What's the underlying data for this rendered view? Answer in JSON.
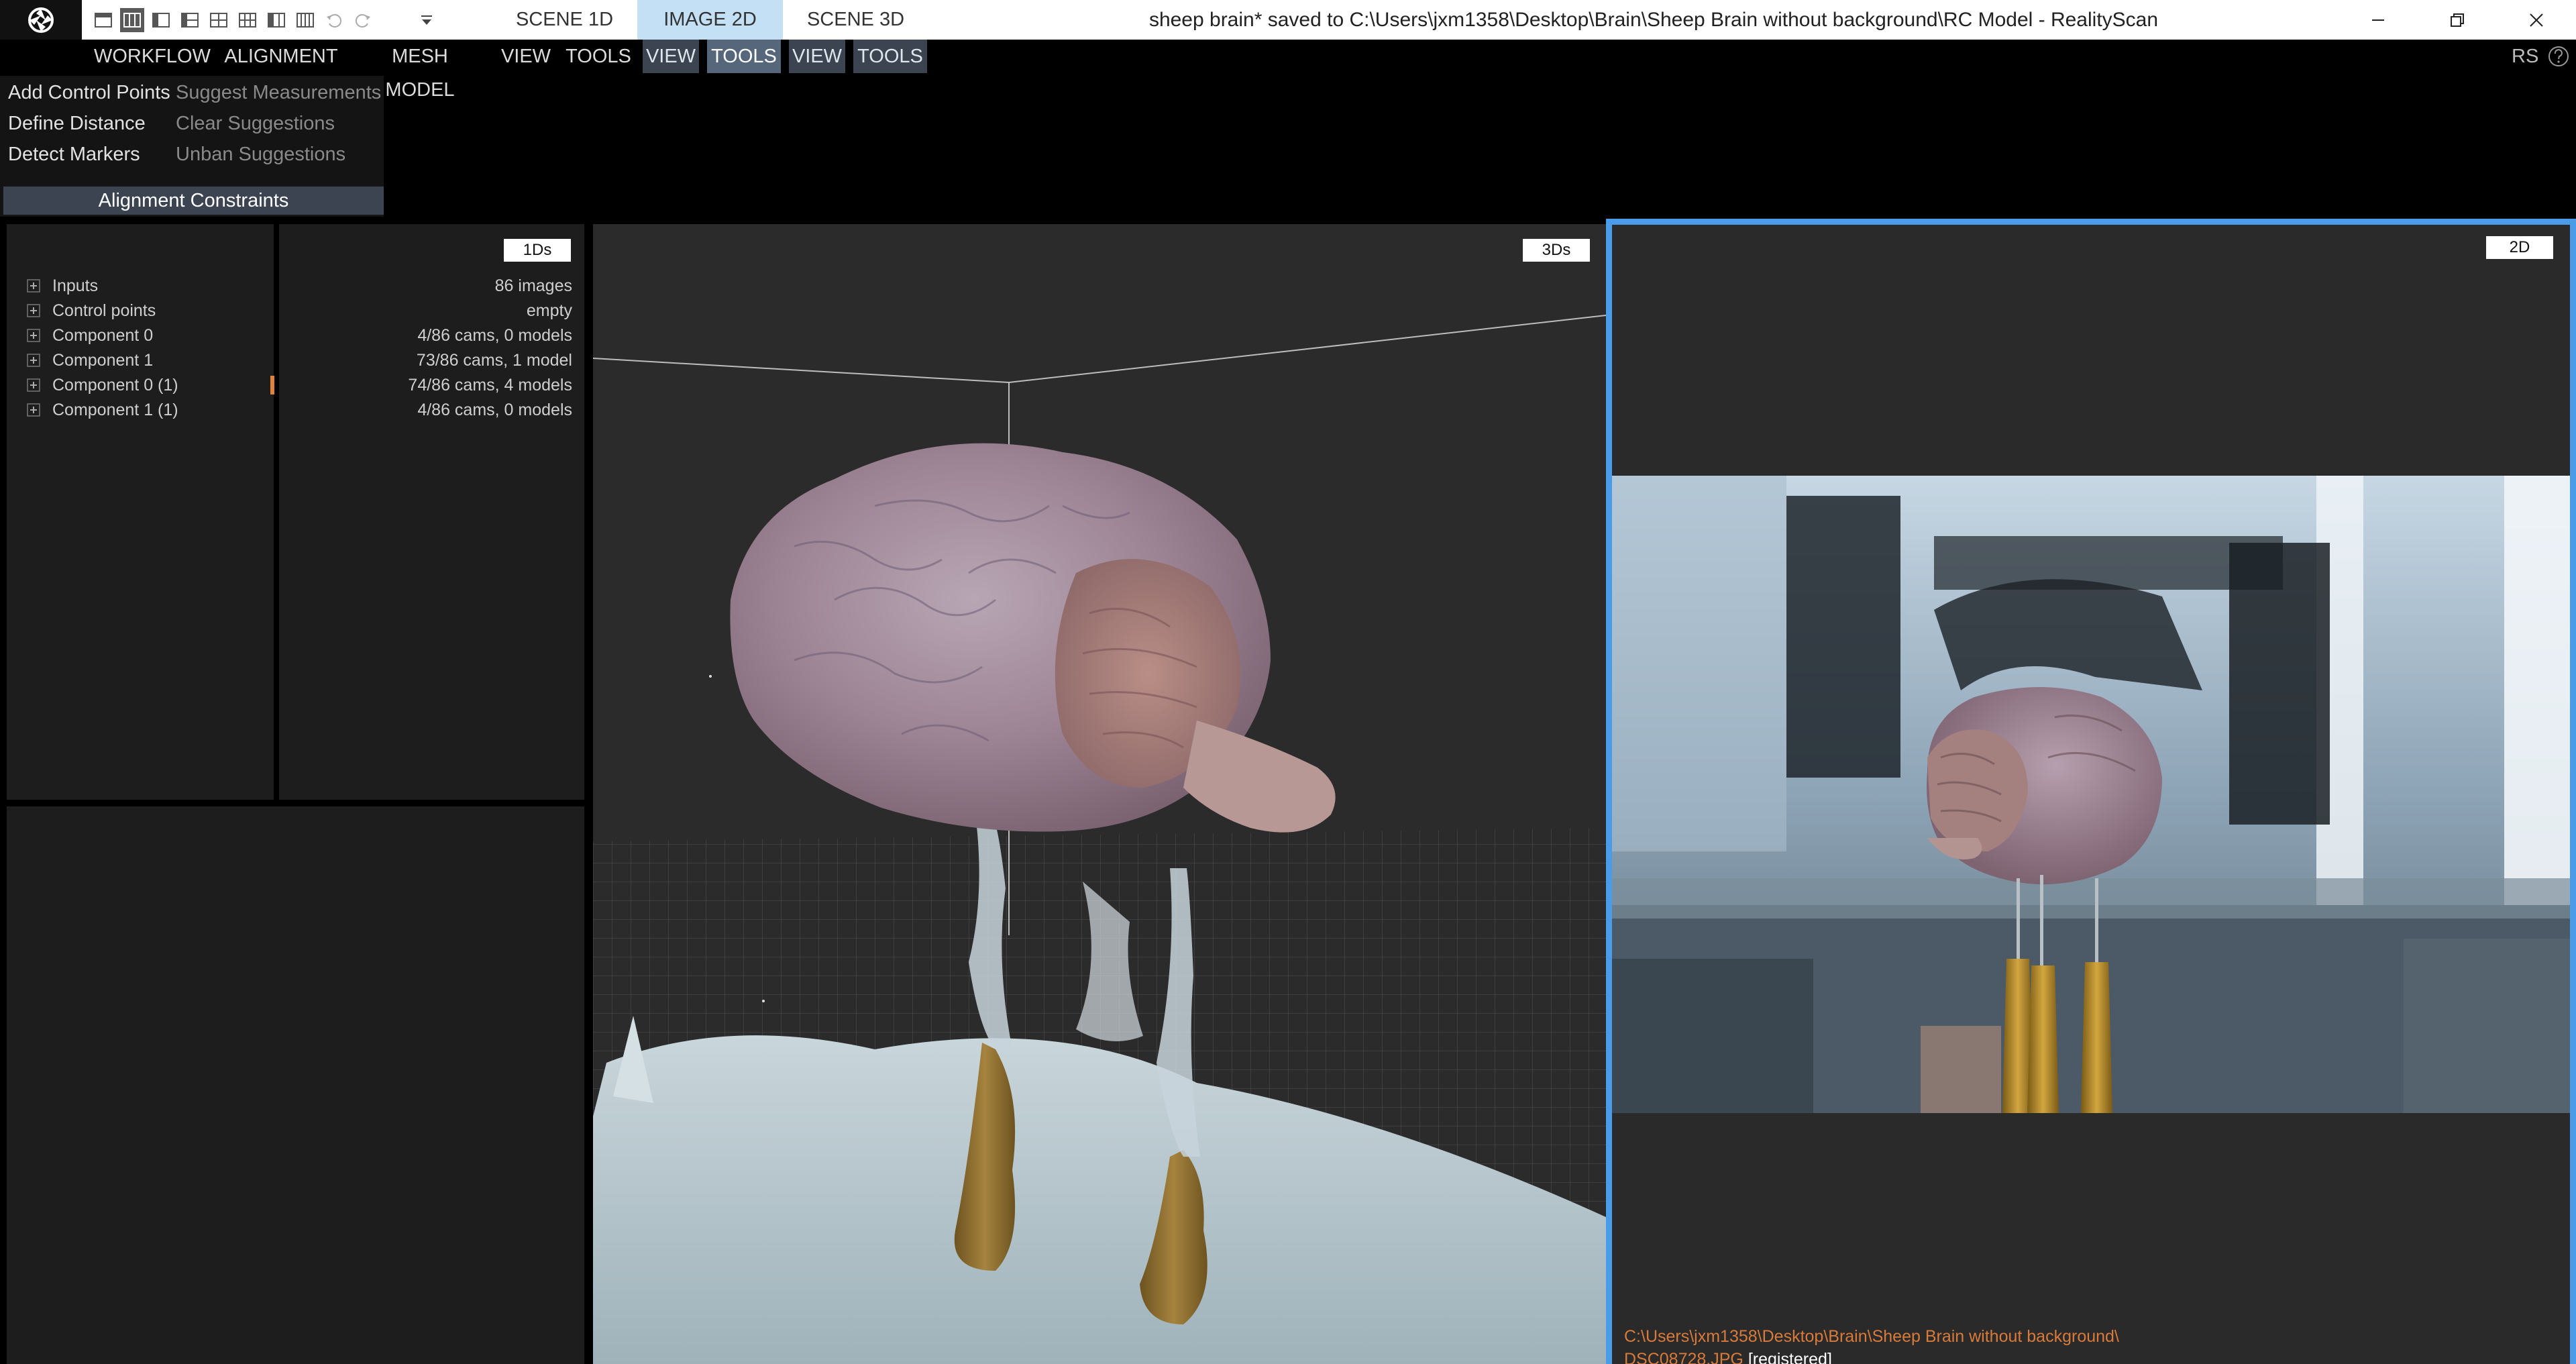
{
  "titlebar": {
    "window_title": "sheep brain* saved to C:\\Users\\jxm1358\\Desktop\\Brain\\Sheep Brain without background\\RC Model - RealityScan",
    "tabs": [
      {
        "label": "SCENE 1D",
        "active": false
      },
      {
        "label": "IMAGE 2D",
        "active": true
      },
      {
        "label": "SCENE 3D",
        "active": false
      }
    ],
    "quick_access_icons": [
      "layout-1-icon",
      "layout-2-icon",
      "layout-3-icon",
      "layout-4-icon",
      "layout-5-icon",
      "layout-6-icon",
      "layout-7-icon",
      "layout-8-icon",
      "undo-icon",
      "redo-icon"
    ],
    "window_buttons": [
      "minimize-icon",
      "restore-icon",
      "close-icon"
    ]
  },
  "menu": {
    "items": [
      "WORKFLOW",
      "ALIGNMENT",
      "MESH MODEL",
      "VIEW",
      "TOOLS"
    ],
    "sub_groups": [
      {
        "view": "VIEW",
        "tools": "TOOLS",
        "tools_active": true
      },
      {
        "view": "VIEW",
        "tools": "TOOLS",
        "tools_active": false
      }
    ],
    "right_label": "RS"
  },
  "ribbon": {
    "col1": [
      "Add Control Points",
      "Define Distance",
      "Detect Markers"
    ],
    "col2": [
      "Suggest Measurements",
      "Clear Suggestions",
      "Unban Suggestions"
    ],
    "group_label": "Alignment Constraints"
  },
  "tree": {
    "tag": "1Ds",
    "rows": [
      {
        "label": "Inputs",
        "value": "86 images"
      },
      {
        "label": "Control points",
        "value": "empty"
      },
      {
        "label": "Component 0",
        "value": "4/86 cams, 0 models"
      },
      {
        "label": "Component 1",
        "value": "73/86 cams, 1 model"
      },
      {
        "label": "Component 0 (1)",
        "value": "74/86 cams, 4 models"
      },
      {
        "label": "Component 1 (1)",
        "value": "4/86 cams, 0 models"
      }
    ]
  },
  "view3d": {
    "tag": "3Ds"
  },
  "view2d": {
    "tag": "2D",
    "path": "C:\\Users\\jxm1358\\Desktop\\Brain\\Sheep Brain without background\\",
    "filename": "DSC08728.JPG",
    "status": "[registered]"
  },
  "colors": {
    "accent_blue": "#4a9be8",
    "tab_active": "#c3e0f4",
    "menu_sub": "#3b4450",
    "accent_orange": "#e1823a"
  }
}
